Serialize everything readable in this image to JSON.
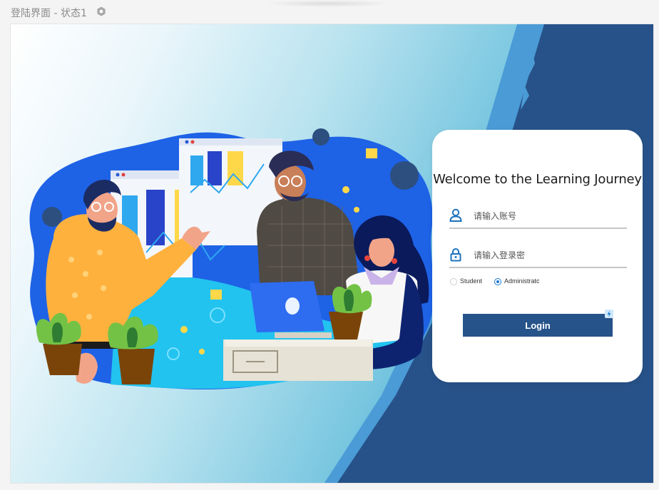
{
  "page": {
    "title": "登陆界面 - 状态1"
  },
  "login": {
    "welcome": "Welcome to the Learning Journey",
    "username_placeholder": "请输入账号",
    "password_placeholder": "请输入登录密",
    "roles": [
      "Student",
      "Administrato"
    ],
    "selected_role": "Administrato",
    "button_label": "Login"
  },
  "colors": {
    "accent": "#26538a",
    "dark_panel": "#275289",
    "light_band": "#4a9bd6",
    "radio_checked": "#1677d2"
  },
  "icons": [
    "info-icon",
    "user-icon",
    "lock-icon",
    "bolt-icon"
  ]
}
